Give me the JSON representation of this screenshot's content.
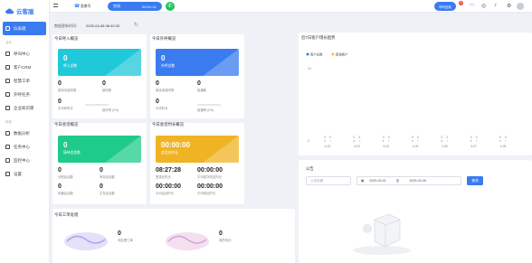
{
  "app": {
    "name": "云客服"
  },
  "sidebar": {
    "items": [
      {
        "label": "仪表盘"
      },
      {
        "group": "业务"
      },
      {
        "label": "呼叫中心"
      },
      {
        "label": "客户CRM"
      },
      {
        "label": "智慧工单"
      },
      {
        "label": "外呼任务"
      },
      {
        "label": "企业知识库"
      },
      {
        "group": "系统"
      },
      {
        "label": "数据分析"
      },
      {
        "label": "任务中心"
      },
      {
        "label": "监控中心"
      },
      {
        "label": "设置"
      }
    ]
  },
  "topbar": {
    "extension": "坐席号",
    "status": "空闲",
    "timer": "00:01:14",
    "user": "呼叫坐席",
    "badge": "6"
  },
  "header": {
    "update_label": "数据更新时间:",
    "update_time": "2025-04-08 08:40:20"
  },
  "today_call": {
    "title": "今日呼入概览",
    "tile_num": "0",
    "tile_label": "呼入总数",
    "stats": [
      {
        "v": "0",
        "l": "接待未接呼数"
      },
      {
        "v": "0",
        "l": "接听数"
      },
      {
        "v": "0",
        "l": "平均呼时长"
      },
      {
        "l": "接听率",
        "v": "(0%)"
      }
    ]
  },
  "today_out": {
    "title": "今日外呼概览",
    "tile_num": "0",
    "tile_label": "外呼总数",
    "stats": [
      {
        "v": "0",
        "l": "接待未接呼数"
      },
      {
        "v": "0",
        "l": "接通数"
      },
      {
        "v": "0",
        "l": "平均时长"
      },
      {
        "l": "接通率",
        "v": "(0%)"
      }
    ]
  },
  "session": {
    "title": "今日会话概览",
    "tile_num": "0",
    "tile_label": "接待会话数",
    "stats": [
      {
        "v": "0",
        "l": "分配会话数"
      },
      {
        "v": "0",
        "l": "有效会话数"
      },
      {
        "v": "0",
        "l": "机器会话数"
      },
      {
        "v": "0",
        "l": "正在会话数"
      }
    ]
  },
  "duration": {
    "title": "今日会话时长概览",
    "tile_num": "00:00:00",
    "tile_label": "会话总时长",
    "stats": [
      {
        "v": "08:27:28",
        "l": "登录总时长"
      },
      {
        "v": "00:00:00",
        "l": "平均首次响应时长"
      },
      {
        "v": "00:00:00",
        "l": "平均会话时长"
      },
      {
        "v": "00:00:00",
        "l": "平均响应时长"
      }
    ]
  },
  "tickets": {
    "title": "今日工单处理",
    "items": [
      {
        "v": "0",
        "l": "待处理工单"
      },
      {
        "v": "0",
        "l": "我的待办"
      }
    ]
  },
  "trend": {
    "title": "近7日客户增长趋势"
  },
  "chart_data": {
    "type": "line",
    "legend": [
      "客户总数",
      "新增客户"
    ],
    "categories": [
      "4-02",
      "4-03",
      "4-04",
      "4-05",
      "4-06",
      "4-07",
      "4-08"
    ],
    "series": [
      {
        "name": "客户总数",
        "values": [
          0,
          0,
          0,
          0,
          0,
          0,
          0
        ]
      },
      {
        "name": "新增客户",
        "values": [
          0,
          0,
          0,
          0,
          0,
          0,
          0
        ]
      }
    ],
    "ylim": [
      0,
      10
    ],
    "ytick": [
      "10",
      "0"
    ],
    "colors": [
      "#3a7bf0",
      "#f5c026"
    ]
  },
  "notice": {
    "title": "公告",
    "search_placeholder": "公告标题",
    "date_from": "2025-04-01",
    "date_sep": "至",
    "date_to": "2025-04-08",
    "button": "查询"
  }
}
